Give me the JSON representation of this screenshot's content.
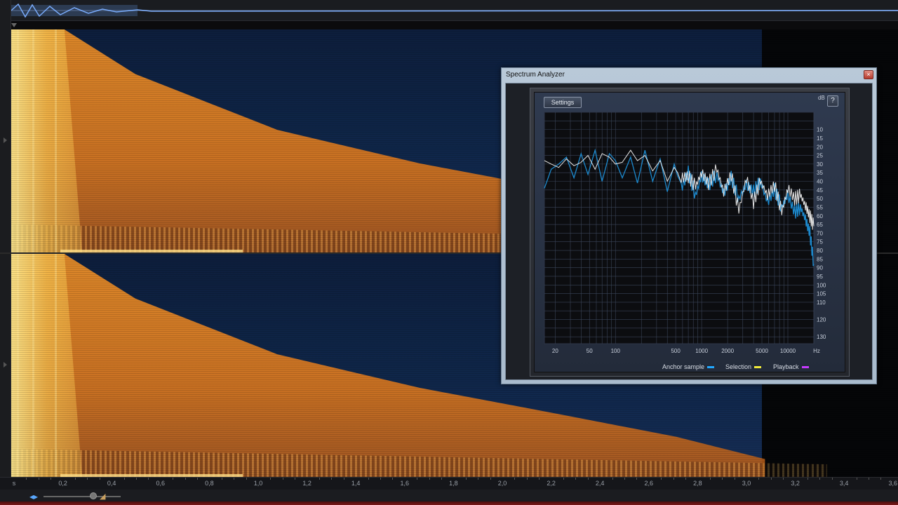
{
  "analyzer": {
    "title": "Spectrum Analyzer",
    "close_glyph": "×",
    "settings_label": "Settings",
    "help_label": "?",
    "db_unit": "dB",
    "db_ticks": [
      10,
      15,
      20,
      25,
      30,
      35,
      40,
      45,
      50,
      55,
      60,
      65,
      70,
      75,
      80,
      85,
      90,
      95,
      100,
      105,
      110,
      120,
      130
    ],
    "db_range": [
      0,
      134
    ],
    "hz_unit": "Hz",
    "freq_ticks": [
      20,
      50,
      100,
      500,
      1000,
      2000,
      5000,
      10000
    ],
    "freq_range": [
      15,
      20000
    ],
    "legend": [
      {
        "label": "Anchor sample",
        "color": "#22a8ff"
      },
      {
        "label": "Selection",
        "color": "#f2ec3a"
      },
      {
        "label": "Playback",
        "color": "#c63aff"
      }
    ],
    "colors": {
      "anchor_line": "#1e90d8",
      "selection_line": "#f0f0f0",
      "grid": "#3a4458",
      "grid_major": "#57627a"
    }
  },
  "time_ruler": {
    "labels": [
      "s",
      "0,2",
      "0,4",
      "0,6",
      "0,8",
      "1,0",
      "1,2",
      "1,4",
      "1,6",
      "1,8",
      "2,0",
      "2,2",
      "2,4",
      "2,6",
      "2,8",
      "3,0",
      "3,2",
      "3,4",
      "3,6"
    ]
  },
  "zoom": {
    "arrows_glyph": "◂▸",
    "end_glyph": "◢"
  },
  "chart_data": {
    "type": "line",
    "x_scale": "log",
    "xlabel": "Hz",
    "ylabel": "dB",
    "xlim": [
      15,
      20000
    ],
    "ylim": [
      0,
      134
    ],
    "y_inverted": true,
    "series": [
      {
        "name": "Anchor sample",
        "x": [
          15,
          18,
          22,
          27,
          33,
          40,
          48,
          58,
          70,
          85,
          100,
          120,
          150,
          180,
          220,
          270,
          330,
          400,
          480,
          580,
          700,
          850,
          1000,
          1200,
          1500,
          1800,
          2200,
          2700,
          3300,
          4000,
          4800,
          5800,
          7000,
          8500,
          10000,
          12000,
          14000,
          16000,
          18000,
          20000
        ],
        "y": [
          44,
          33,
          30,
          26,
          38,
          24,
          36,
          22,
          40,
          24,
          28,
          38,
          26,
          41,
          22,
          40,
          27,
          46,
          30,
          44,
          35,
          48,
          37,
          42,
          36,
          47,
          38,
          50,
          42,
          46,
          40,
          52,
          45,
          55,
          48,
          58,
          55,
          62,
          70,
          88
        ]
      },
      {
        "name": "Selection",
        "x": [
          15,
          18,
          22,
          27,
          33,
          40,
          48,
          58,
          70,
          85,
          100,
          120,
          150,
          180,
          220,
          270,
          330,
          400,
          480,
          580,
          700,
          850,
          1000,
          1200,
          1500,
          1800,
          2200,
          2700,
          3300,
          4000,
          4800,
          5800,
          7000,
          8500,
          10000,
          12000,
          14000,
          16000,
          18000,
          20000
        ],
        "y": [
          28,
          30,
          32,
          27,
          31,
          29,
          25,
          33,
          24,
          26,
          30,
          29,
          22,
          28,
          25,
          34,
          28,
          40,
          32,
          38,
          37,
          43,
          35,
          41,
          33,
          46,
          36,
          57,
          38,
          52,
          40,
          48,
          42,
          58,
          44,
          50,
          48,
          54,
          60,
          66
        ]
      }
    ]
  }
}
